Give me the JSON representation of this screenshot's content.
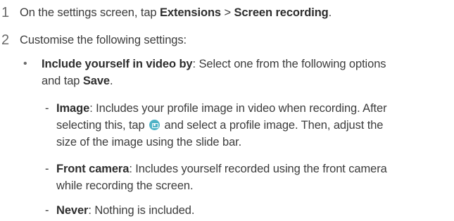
{
  "steps": [
    {
      "number": "1",
      "text_prefix": "On the settings screen, tap ",
      "bold_1": "Extensions",
      "separator": " > ",
      "bold_2": "Screen recording",
      "text_suffix": "."
    },
    {
      "number": "2",
      "text": "Customise the following settings:"
    }
  ],
  "bullet": {
    "symbol": "•",
    "bold": "Include yourself in video by",
    "text_line1": ": Select one from the following options",
    "text_line2_prefix": "and tap ",
    "text_line2_bold": "Save",
    "text_line2_suffix": "."
  },
  "options": [
    {
      "dash": "-",
      "bold": "Image",
      "line1": ": Includes your profile image in video when recording. After",
      "line2_prefix": "selecting this, tap ",
      "line2_icon": "camera-icon",
      "line2_suffix": " and select a profile image. Then, adjust the",
      "line3": "size of the image using the slide bar."
    },
    {
      "dash": "-",
      "bold": "Front camera",
      "line1": ": Includes yourself recorded using the front camera",
      "line2": "while recording the screen."
    },
    {
      "dash": "-",
      "bold": "Never",
      "line1": ": Nothing is included."
    }
  ],
  "colors": {
    "text": "#3c3c3c",
    "bold_text": "#2e2e2e",
    "icon_bg": "#4fb3c6"
  }
}
